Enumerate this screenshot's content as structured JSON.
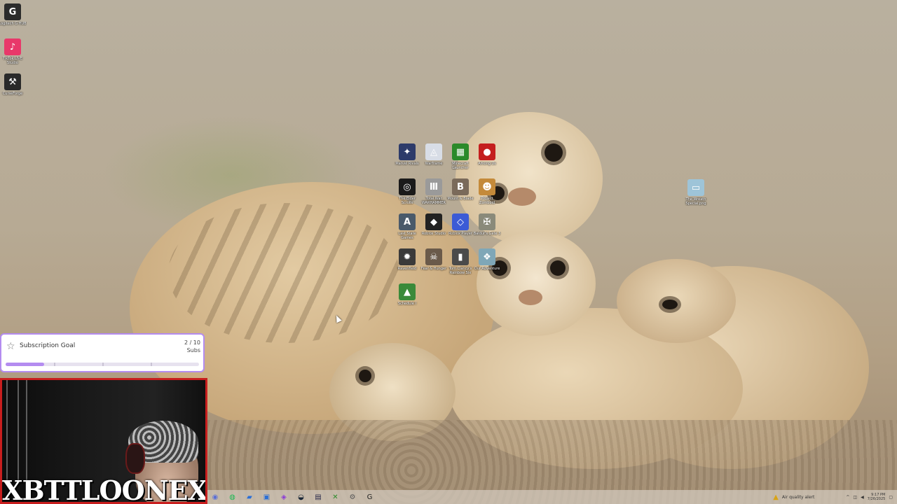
{
  "desktop": {
    "left_icons": [
      {
        "name": "logitech-g-hub-icon",
        "label": "Logitech G HUB",
        "color": "#2b2b2b",
        "glyph": "G"
      },
      {
        "name": "tiktok-live-studio-icon",
        "label": "TikTok LIVE Studio",
        "color": "#e8386a",
        "glyph": "♪"
      },
      {
        "name": "curseforge-icon",
        "label": "CurseForge",
        "color": "#2a2a2a",
        "glyph": "⚒"
      }
    ],
    "center_icons": [
      {
        "name": "game-icon-1",
        "label": "Marvel Rivals",
        "color": "#2d3b6a",
        "glyph": "✦"
      },
      {
        "name": "warframe-icon",
        "label": "Warframe",
        "color": "#d8dde6",
        "glyph": "◬"
      },
      {
        "name": "minecraft-launcher-icon",
        "label": "Minecraft Launcher",
        "color": "#2a8a2a",
        "glyph": "▦"
      },
      {
        "name": "among-us-icon",
        "label": "Among Us",
        "color": "#c41e1e",
        "glyph": "●"
      },
      {
        "name": "elder-scrolls-icon",
        "label": "The Elder Scrolls",
        "color": "#1a1a1a",
        "glyph": "◎"
      },
      {
        "name": "total-war-icon",
        "label": "Total War WARHAMMER",
        "color": "#9a9a9a",
        "glyph": "Ⅲ"
      },
      {
        "name": "mount-blade-icon",
        "label": "Mount & Blade",
        "color": "#7a6a5a",
        "glyph": "B"
      },
      {
        "name": "project-zomboid-icon",
        "label": "Project Zomboid",
        "color": "#c48a3a",
        "glyph": "☻"
      },
      {
        "name": "arc-state-icon",
        "label": "Last State Games",
        "color": "#4a5a6a",
        "glyph": "A"
      },
      {
        "name": "roblox-studio-icon",
        "label": "Roblox Studio",
        "color": "#222222",
        "glyph": "◆"
      },
      {
        "name": "roblox-player-icon",
        "label": "Roblox Player",
        "color": "#3b5bd6",
        "glyph": "◇"
      },
      {
        "name": "baldurs-gate-icon",
        "label": "Baldur's Gate 3",
        "color": "#8a8a7a",
        "glyph": "✠"
      },
      {
        "name": "icon-13",
        "label": "Ravenfield",
        "color": "#3a3a3a",
        "glyph": "✹"
      },
      {
        "name": "fear-hunger-icon",
        "label": "Fear & Hunger",
        "color": "#6a5a4a",
        "glyph": "☠"
      },
      {
        "name": "rainbow-six-icon",
        "label": "Tom Clancy's Rainbow Six Siege X",
        "color": "#4a4a4a",
        "glyph": "▮"
      },
      {
        "name": "icon-16",
        "label": "Our Adventure",
        "color": "#7fa7b7",
        "glyph": "❖"
      },
      {
        "name": "schedule-icon",
        "label": "Schedule I",
        "color": "#3a8a3a",
        "glyph": "▲"
      }
    ],
    "right_icon": {
      "name": "file-icon",
      "label": "The Wreath Special.png",
      "color": "#9ec4d8",
      "glyph": "▭"
    }
  },
  "goal_widget": {
    "title": "Subscription Goal",
    "current": "2 / 10",
    "unit": "Subs",
    "progress": 0.2,
    "accent": "#b48cf0"
  },
  "webcam": {
    "banner": "XBTTLOONEXX",
    "border_color": "#c81e1e"
  },
  "taskbar": {
    "apps": [
      {
        "name": "browser-icon",
        "glyph": "◉",
        "color": "#5a6fd6"
      },
      {
        "name": "spotify-icon",
        "glyph": "◍",
        "color": "#1db954"
      },
      {
        "name": "files-icon",
        "glyph": "▰",
        "color": "#2b6fd6"
      },
      {
        "name": "store-icon",
        "glyph": "▣",
        "color": "#2b6fd6"
      },
      {
        "name": "obs-icon",
        "glyph": "◈",
        "color": "#8a3ad6"
      },
      {
        "name": "steam-icon",
        "glyph": "◒",
        "color": "#1b2838"
      },
      {
        "name": "app-icon",
        "glyph": "▤",
        "color": "#2a2a4a"
      },
      {
        "name": "xbox-icon",
        "glyph": "✕",
        "color": "#2a8a2a"
      },
      {
        "name": "settings-icon",
        "glyph": "⚙",
        "color": "#555555"
      },
      {
        "name": "g-hub-icon",
        "glyph": "G",
        "color": "#222222"
      }
    ],
    "tray": {
      "alert": "Air quality alert",
      "time": "9:17 PM",
      "date": "7/26/2025"
    }
  }
}
